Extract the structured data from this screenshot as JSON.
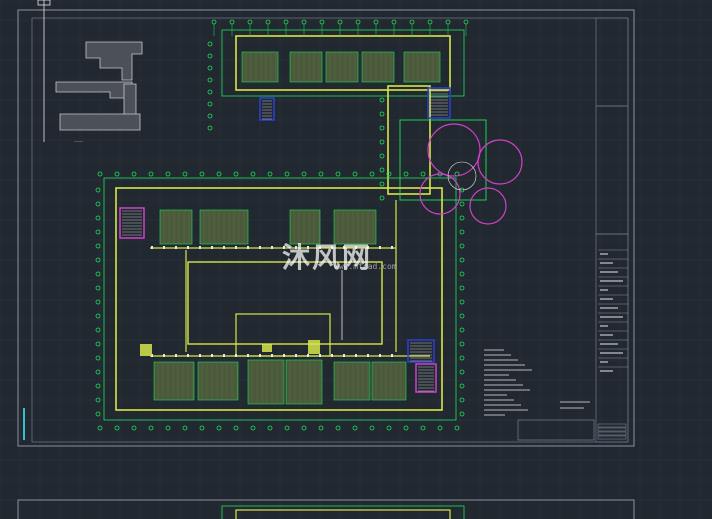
{
  "drawing": {
    "background": "#212830",
    "colors": {
      "grid": "#2c3440",
      "frame": "#8a90a0",
      "wall": "#d6e64a",
      "axis": "#1fe05a",
      "room": "#4a5a3a",
      "magenta": "#d040c8",
      "blue": "#2a40d8",
      "white": "#e8e8e8",
      "cyan": "#30c0d0"
    }
  },
  "watermark": {
    "text": "沐风网",
    "url": "www.mfcad.com"
  },
  "icons": [
    "key-plan-icon",
    "watermark-logo-icon"
  ]
}
